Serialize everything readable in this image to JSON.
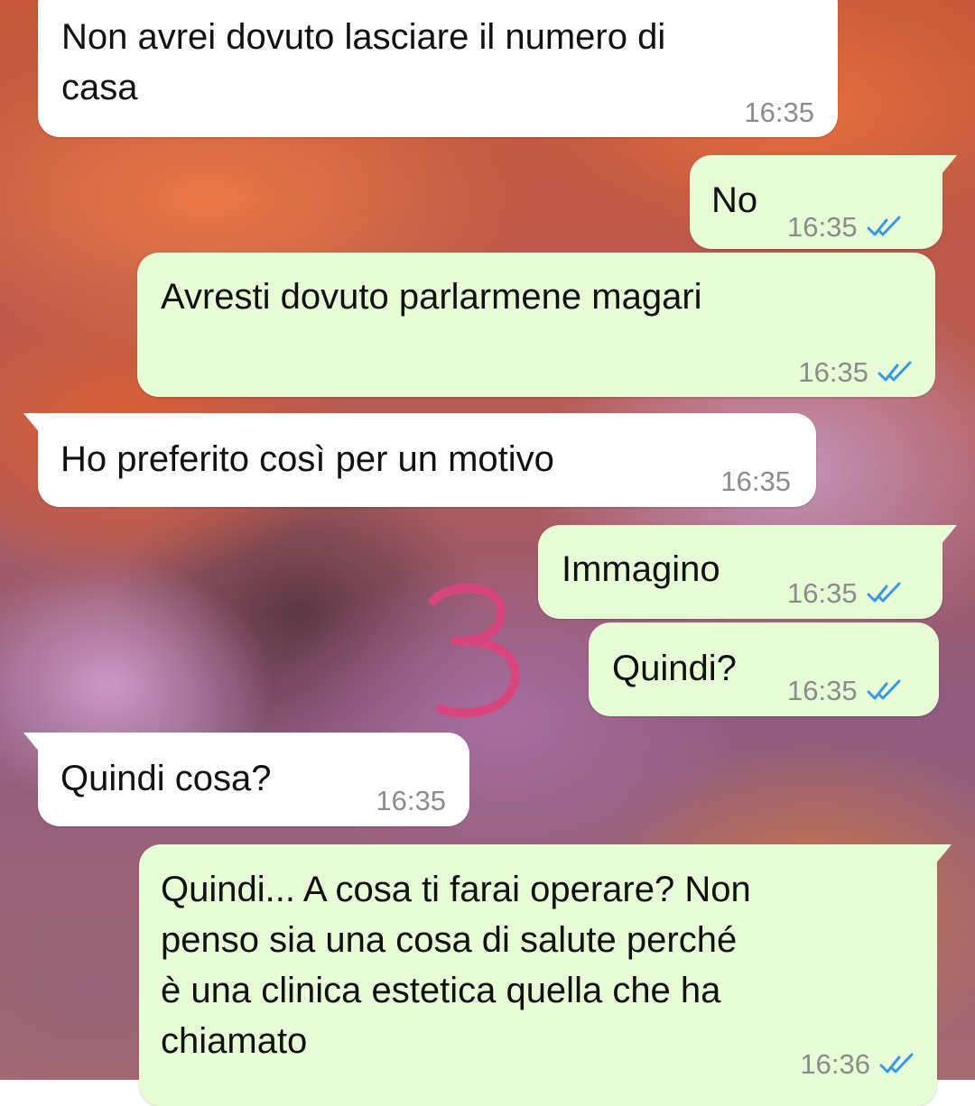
{
  "messages": [
    {
      "direction": "incoming",
      "text": "Non avrei dovuto lasciare il numero di\ncasa",
      "time": "16:35"
    },
    {
      "direction": "outgoing",
      "text": "No",
      "time": "16:35",
      "status": "read"
    },
    {
      "direction": "outgoing",
      "text": "Avresti dovuto parlarmene magari",
      "time": "16:35",
      "status": "read"
    },
    {
      "direction": "incoming",
      "text": "Ho preferito così per un motivo",
      "time": "16:35"
    },
    {
      "direction": "outgoing",
      "text": "Immagino",
      "time": "16:35",
      "status": "read"
    },
    {
      "direction": "outgoing",
      "text": "Quindi?",
      "time": "16:35",
      "status": "read"
    },
    {
      "direction": "incoming",
      "text": "Quindi cosa?",
      "time": "16:35"
    },
    {
      "direction": "outgoing",
      "text": "Quindi... A cosa ti farai operare? Non\npenso sia una cosa di salute perché\nè una clinica estetica quella che ha\nchiamato",
      "time": "16:36",
      "status": "read"
    }
  ],
  "annotation": {
    "text": "3",
    "color": "#d8467e"
  },
  "colors": {
    "incoming_bubble": "#ffffff",
    "outgoing_bubble": "#e7fbd6",
    "timestamp": "#8c8c8c",
    "read_tick": "#3b97e8"
  },
  "icons": {
    "read_receipt": "double-check-icon"
  }
}
